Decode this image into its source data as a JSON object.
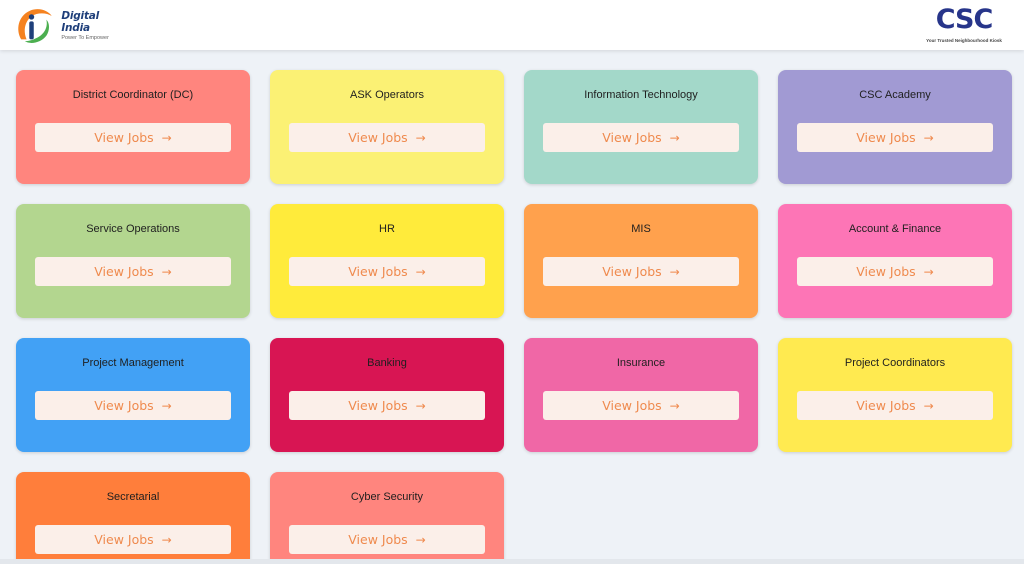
{
  "header": {
    "digital_india_title": "Digital India",
    "digital_india_tagline": "Power To Empower",
    "csc_wordmark": "CSC",
    "csc_tagline": "Your Trusted Neighbourhood Kiosk"
  },
  "cards": [
    {
      "title": "District Coordinator (DC)",
      "button": "View Jobs",
      "icon": "arrow-right-icon",
      "color": "#ff857e"
    },
    {
      "title": "ASK Operators",
      "button": "View Jobs",
      "icon": "arrow-right-icon",
      "color": "#fbf174"
    },
    {
      "title": "Information Technology",
      "button": "View Jobs",
      "icon": "arrow-right-icon",
      "color": "#a3d8c9"
    },
    {
      "title": "CSC Academy",
      "button": "View Jobs",
      "icon": "arrow-right-icon",
      "color": "#a19ad3"
    },
    {
      "title": "Service Operations",
      "button": "View Jobs",
      "icon": "arrow-right-icon",
      "color": "#b3d68f"
    },
    {
      "title": "HR",
      "button": "View Jobs",
      "icon": "arrow-right-icon",
      "color": "#ffeb3b"
    },
    {
      "title": "MIS",
      "button": "View Jobs",
      "icon": "arrow-right-icon",
      "color": "#ffa14d"
    },
    {
      "title": "Account & Finance",
      "button": "View Jobs",
      "icon": "arrow-right-icon",
      "color": "#fd75b6"
    },
    {
      "title": "Project Management",
      "button": "View Jobs",
      "icon": "arrow-right-icon",
      "color": "#42a1f5"
    },
    {
      "title": "Banking",
      "button": "View Jobs",
      "icon": "arrow-right-icon",
      "color": "#d81553"
    },
    {
      "title": "Insurance",
      "button": "View Jobs",
      "icon": "arrow-right-icon",
      "color": "#f067a6"
    },
    {
      "title": "Project Coordinators",
      "button": "View Jobs",
      "icon": "arrow-right-icon",
      "color": "#ffea50"
    },
    {
      "title": "Secretarial",
      "button": "View Jobs",
      "icon": "arrow-right-icon",
      "color": "#ff7e3b"
    },
    {
      "title": "Cyber Security",
      "button": "View Jobs",
      "icon": "arrow-right-icon",
      "color": "#ff857e"
    }
  ],
  "theme": {
    "button_text_color": "#ef8a4e",
    "button_background": "#fbefe9",
    "page_background": "#eef2f7"
  }
}
